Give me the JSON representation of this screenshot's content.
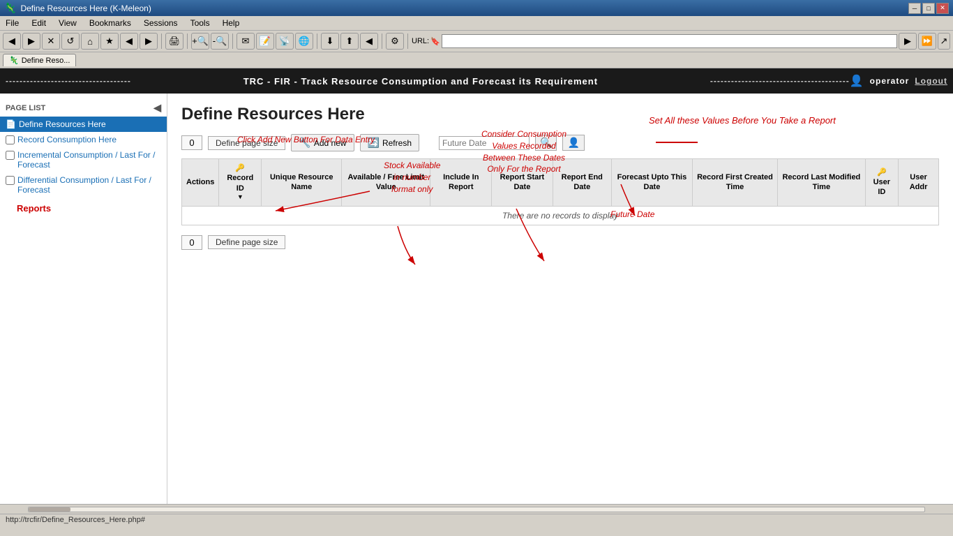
{
  "browser": {
    "title": "Define Resources Here (K-Meleon)",
    "tab_label": "Define Reso...",
    "url": "http://trcfir/Define_Resources_Here.php",
    "status_bar": "http://trcfir/Define_Resources_Here.php#"
  },
  "app_header": {
    "title": "TRC - FIR - Track Resource Consumption and Forecast its Requirement",
    "dashes_left": "----------------------------------------------------------------------------------------------------",
    "dashes_right": "-----------------------------------------------------",
    "user_label": "operator",
    "logout_label": "Logout"
  },
  "sidebar": {
    "page_list_label": "PAGE LIST",
    "items": [
      {
        "id": "define-resources",
        "label": "Define Resources Here",
        "active": true,
        "has_checkbox": false
      },
      {
        "id": "record-consumption",
        "label": "Record Consumption Here",
        "active": false,
        "has_checkbox": true
      },
      {
        "id": "incremental-consumption",
        "label": "Incremental Consumption / Last For / Forecast",
        "active": false,
        "has_checkbox": true
      },
      {
        "id": "differential-consumption",
        "label": "Differential Consumption / Last For / Forecast",
        "active": false,
        "has_checkbox": true
      }
    ],
    "reports_label": "Reports"
  },
  "content": {
    "page_title": "Define Resources Here",
    "toolbar": {
      "page_size_value": "0",
      "page_size_label": "Define page size",
      "add_new_label": "Add new",
      "refresh_label": "Refresh",
      "date_placeholder": "Future Date"
    },
    "annotations": {
      "add_new_note": "Click Add New Button For Data Entry",
      "stock_note": "Stock Available\nin number\nformat only",
      "consumption_note": "Consider Consumption\nValues Recorded\nBetween These Dates\nOnly For the Report",
      "set_values_note": "Set All these Values Before You Take a Report",
      "future_date_note": "Future Date"
    },
    "table": {
      "columns": [
        {
          "id": "actions",
          "label": "Actions"
        },
        {
          "id": "record-id",
          "label": "Record ID",
          "has_sort": true
        },
        {
          "id": "resource-name",
          "label": "Unique Resource Name"
        },
        {
          "id": "free-limit",
          "label": "Available / Free Limit Value"
        },
        {
          "id": "include-report",
          "label": "Include In Report"
        },
        {
          "id": "report-start",
          "label": "Report Start Date"
        },
        {
          "id": "report-end",
          "label": "Report End Date"
        },
        {
          "id": "forecast-upto",
          "label": "Forecast Upto This Date"
        },
        {
          "id": "first-created",
          "label": "Record First Created Time"
        },
        {
          "id": "last-modified",
          "label": "Record Last Modified Time"
        },
        {
          "id": "user-id",
          "label": "User ID"
        },
        {
          "id": "user-addr",
          "label": "User Addr"
        }
      ],
      "no_records_message": "There are no records to display"
    },
    "bottom_toolbar": {
      "page_size_value": "0",
      "page_size_label": "Define page size"
    }
  },
  "icons": {
    "page": "📄",
    "add": "🔧",
    "refresh": "🔄",
    "search": "🔍",
    "user": "👤",
    "key": "🔑",
    "back": "◀",
    "forward": "▶",
    "stop": "✕",
    "reload": "↺",
    "home": "⌂",
    "bookmark": "★",
    "zoom_in": "🔍",
    "zoom_out": "🔍"
  }
}
